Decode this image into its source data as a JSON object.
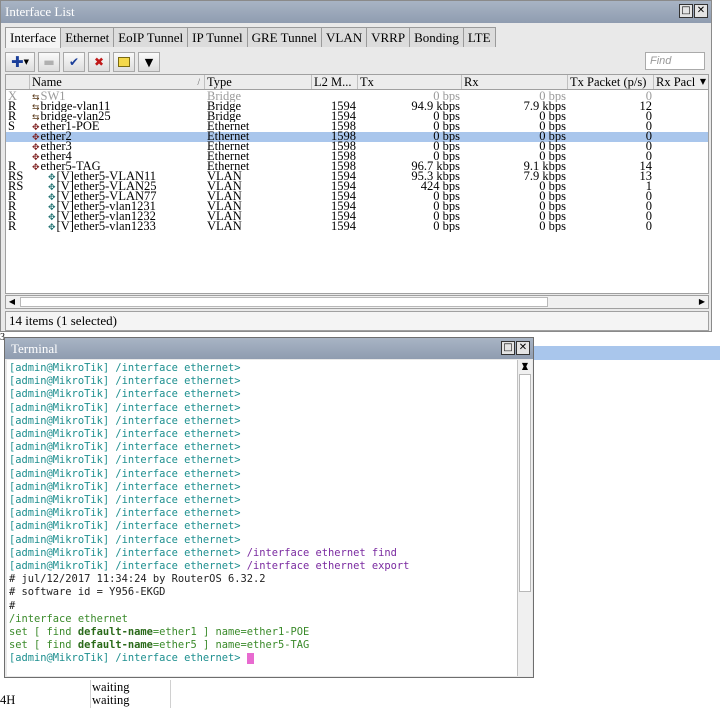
{
  "interface_window": {
    "title": "Interface List",
    "tabs": [
      "Interface",
      "Ethernet",
      "EoIP Tunnel",
      "IP Tunnel",
      "GRE Tunnel",
      "VLAN",
      "VRRP",
      "Bonding",
      "LTE"
    ],
    "find_placeholder": "Find",
    "columns": [
      "Name",
      "Type",
      "L2 M...",
      "Tx",
      "Rx",
      "Tx Packet (p/s)",
      "Rx Pacl"
    ],
    "sort_indicator": "/",
    "rows": [
      {
        "flag": "X",
        "icon": "bridge-icon",
        "name": "SW1",
        "type": "Bridge",
        "l2mtu": "",
        "tx": "0 bps",
        "rx": "0 bps",
        "txp": "0",
        "disabled": true,
        "selected": false
      },
      {
        "flag": "R",
        "icon": "bridge-icon",
        "name": "bridge-vlan11",
        "type": "Bridge",
        "l2mtu": "1594",
        "tx": "94.9 kbps",
        "rx": "7.9 kbps",
        "txp": "12",
        "disabled": false,
        "selected": false
      },
      {
        "flag": "R",
        "icon": "bridge-icon",
        "name": "bridge-vlan25",
        "type": "Bridge",
        "l2mtu": "1594",
        "tx": "0 bps",
        "rx": "0 bps",
        "txp": "0",
        "disabled": false,
        "selected": false
      },
      {
        "flag": "S",
        "icon": "ethernet-icon",
        "name": "ether1-POE",
        "type": "Ethernet",
        "l2mtu": "1598",
        "tx": "0 bps",
        "rx": "0 bps",
        "txp": "0",
        "disabled": false,
        "selected": false
      },
      {
        "flag": "",
        "icon": "ethernet-icon",
        "name": "ether2",
        "type": "Ethernet",
        "l2mtu": "1598",
        "tx": "0 bps",
        "rx": "0 bps",
        "txp": "0",
        "disabled": false,
        "selected": true
      },
      {
        "flag": "",
        "icon": "ethernet-icon",
        "name": "ether3",
        "type": "Ethernet",
        "l2mtu": "1598",
        "tx": "0 bps",
        "rx": "0 bps",
        "txp": "0",
        "disabled": false,
        "selected": false
      },
      {
        "flag": "",
        "icon": "ethernet-icon",
        "name": "ether4",
        "type": "Ethernet",
        "l2mtu": "1598",
        "tx": "0 bps",
        "rx": "0 bps",
        "txp": "0",
        "disabled": false,
        "selected": false
      },
      {
        "flag": "R",
        "icon": "ethernet-icon",
        "name": "ether5-TAG",
        "type": "Ethernet",
        "l2mtu": "1598",
        "tx": "96.7 kbps",
        "rx": "9.1 kbps",
        "txp": "14",
        "disabled": false,
        "selected": false
      },
      {
        "flag": "RS",
        "icon": "vlan-icon",
        "name": "[V]ether5-VLAN11",
        "type": "VLAN",
        "l2mtu": "1594",
        "tx": "95.3 kbps",
        "rx": "7.9 kbps",
        "txp": "13",
        "disabled": false,
        "selected": false
      },
      {
        "flag": "RS",
        "icon": "vlan-icon",
        "name": "[V]ether5-VLAN25",
        "type": "VLAN",
        "l2mtu": "1594",
        "tx": "424 bps",
        "rx": "0 bps",
        "txp": "1",
        "disabled": false,
        "selected": false
      },
      {
        "flag": "R",
        "icon": "vlan-icon",
        "name": "[V]ether5-VLAN77",
        "type": "VLAN",
        "l2mtu": "1594",
        "tx": "0 bps",
        "rx": "0 bps",
        "txp": "0",
        "disabled": false,
        "selected": false
      },
      {
        "flag": "R",
        "icon": "vlan-icon",
        "name": "[V]ether5-vlan1231",
        "type": "VLAN",
        "l2mtu": "1594",
        "tx": "0 bps",
        "rx": "0 bps",
        "txp": "0",
        "disabled": false,
        "selected": false
      },
      {
        "flag": "R",
        "icon": "vlan-icon",
        "name": "[V]ether5-vlan1232",
        "type": "VLAN",
        "l2mtu": "1594",
        "tx": "0 bps",
        "rx": "0 bps",
        "txp": "0",
        "disabled": false,
        "selected": false
      },
      {
        "flag": "R",
        "icon": "vlan-icon",
        "name": "[V]ether5-vlan1233",
        "type": "VLAN",
        "l2mtu": "1594",
        "tx": "0 bps",
        "rx": "0 bps",
        "txp": "0",
        "disabled": false,
        "selected": false
      }
    ],
    "status": "14 items (1 selected)"
  },
  "terminal": {
    "title": "Terminal",
    "prompt_user": "[admin@MikroTik]",
    "prompt_path": " /interface ethernet>",
    "lines": [
      {
        "kind": "prompt",
        "cmd": ""
      },
      {
        "kind": "prompt",
        "cmd": ""
      },
      {
        "kind": "prompt",
        "cmd": ""
      },
      {
        "kind": "prompt",
        "cmd": ""
      },
      {
        "kind": "prompt",
        "cmd": ""
      },
      {
        "kind": "prompt",
        "cmd": ""
      },
      {
        "kind": "prompt",
        "cmd": ""
      },
      {
        "kind": "prompt",
        "cmd": ""
      },
      {
        "kind": "prompt",
        "cmd": ""
      },
      {
        "kind": "prompt",
        "cmd": ""
      },
      {
        "kind": "prompt",
        "cmd": ""
      },
      {
        "kind": "prompt",
        "cmd": ""
      },
      {
        "kind": "prompt",
        "cmd": ""
      },
      {
        "kind": "prompt",
        "cmd": ""
      },
      {
        "kind": "prompt",
        "cmd": " /interface ethernet",
        "cmd2": " find"
      },
      {
        "kind": "prompt",
        "cmd": " /interface ethernet",
        "cmd2": " export"
      },
      {
        "kind": "plain",
        "text": "# jul/12/2017 11:34:24 by RouterOS 6.32.2"
      },
      {
        "kind": "plain",
        "text": "# software id = Y956-EKGD"
      },
      {
        "kind": "plain",
        "text": "#"
      },
      {
        "kind": "green",
        "text": "/interface ethernet"
      },
      {
        "kind": "set",
        "pre": "set [ find ",
        "key": "default-name",
        "mid": "=ether1 ] name=ether1-POE"
      },
      {
        "kind": "set",
        "pre": "set [ find ",
        "key": "default-name",
        "mid": "=ether5 ] name=ether5-TAG"
      },
      {
        "kind": "prompt",
        "cmd": " ",
        "cursor": true
      }
    ]
  },
  "background": {
    "left_marker": "3",
    "rows": [
      "waiting",
      "waiting"
    ],
    "left_label": "4H"
  }
}
